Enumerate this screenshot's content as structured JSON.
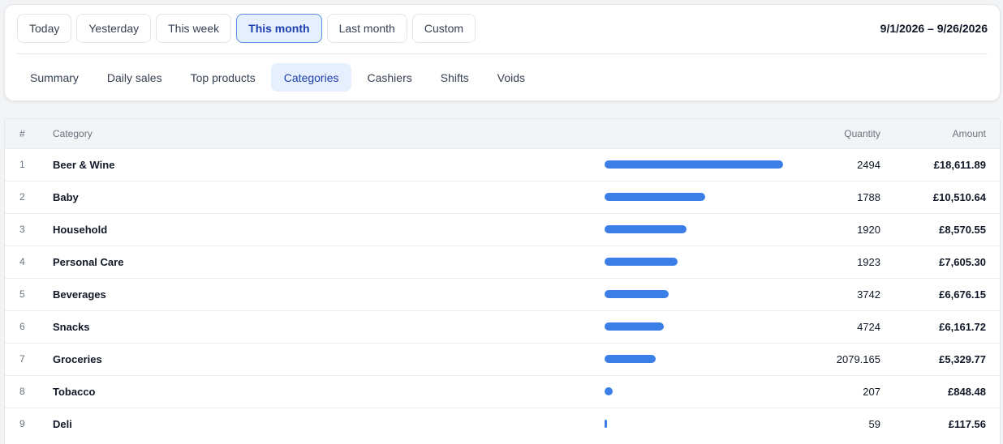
{
  "period": {
    "buttons": [
      {
        "label": "Today",
        "active": false
      },
      {
        "label": "Yesterday",
        "active": false
      },
      {
        "label": "This week",
        "active": false
      },
      {
        "label": "This month",
        "active": true
      },
      {
        "label": "Last month",
        "active": false
      },
      {
        "label": "Custom",
        "active": false
      }
    ],
    "date_range": "9/1/2026 – 9/26/2026"
  },
  "tabs": [
    {
      "label": "Summary",
      "active": false
    },
    {
      "label": "Daily sales",
      "active": false
    },
    {
      "label": "Top products",
      "active": false
    },
    {
      "label": "Categories",
      "active": true
    },
    {
      "label": "Cashiers",
      "active": false
    },
    {
      "label": "Shifts",
      "active": false
    },
    {
      "label": "Voids",
      "active": false
    }
  ],
  "table": {
    "headers": {
      "index": "#",
      "category": "Category",
      "quantity": "Quantity",
      "amount": "Amount"
    },
    "rows": [
      {
        "index": "1",
        "category": "Beer & Wine",
        "quantity": "2494",
        "amount": "£18,611.89",
        "share": 1.0
      },
      {
        "index": "2",
        "category": "Baby",
        "quantity": "1788",
        "amount": "£10,510.64",
        "share": 0.5647
      },
      {
        "index": "3",
        "category": "Household",
        "quantity": "1920",
        "amount": "£8,570.55",
        "share": 0.4605
      },
      {
        "index": "4",
        "category": "Personal Care",
        "quantity": "1923",
        "amount": "£7,605.30",
        "share": 0.4086
      },
      {
        "index": "5",
        "category": "Beverages",
        "quantity": "3742",
        "amount": "£6,676.15",
        "share": 0.3587
      },
      {
        "index": "6",
        "category": "Snacks",
        "quantity": "4724",
        "amount": "£6,161.72",
        "share": 0.3311
      },
      {
        "index": "7",
        "category": "Groceries",
        "quantity": "2079.165",
        "amount": "£5,329.77",
        "share": 0.2864
      },
      {
        "index": "8",
        "category": "Tobacco",
        "quantity": "207",
        "amount": "£848.48",
        "share": 0.0456
      },
      {
        "index": "9",
        "category": "Deli",
        "quantity": "59",
        "amount": "£117.56",
        "share": 0.0063
      }
    ]
  },
  "colors": {
    "accent": "#3b7ee8",
    "active_bg": "#e6effd",
    "active_text": "#1e40af"
  }
}
